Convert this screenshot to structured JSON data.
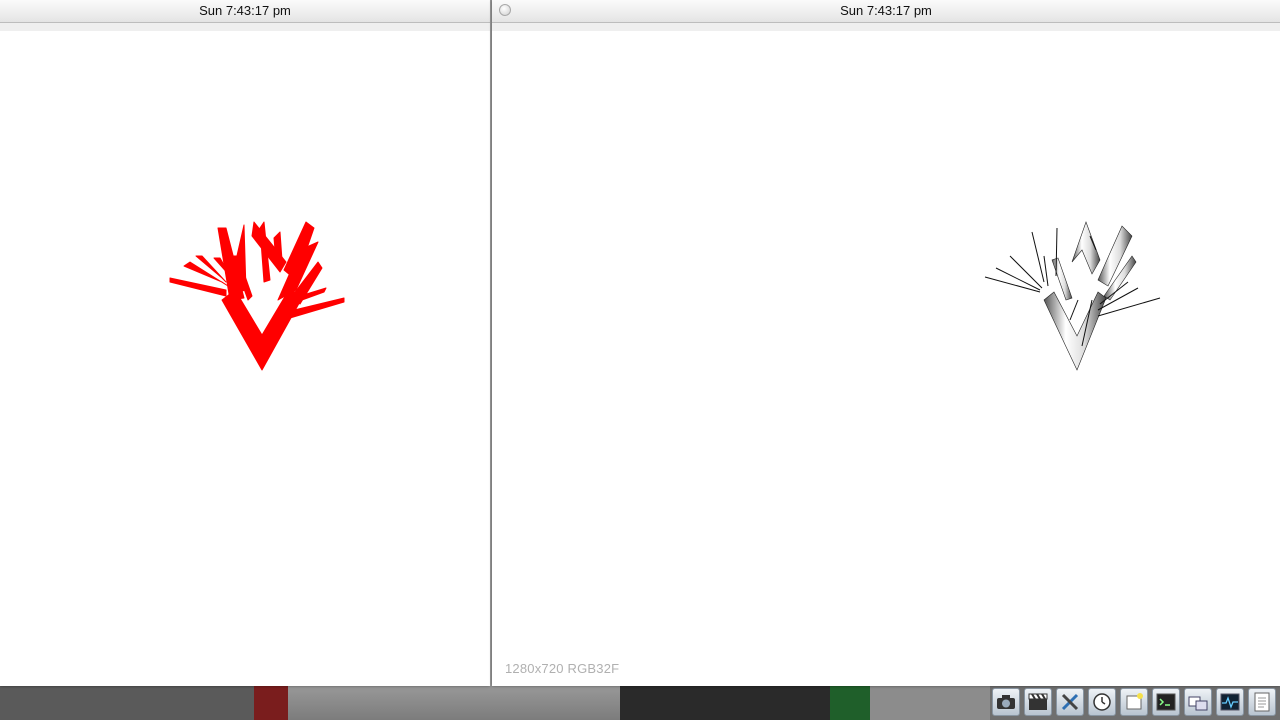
{
  "left_window": {
    "title": "Sun 7:43:17 pm",
    "render_color": "#ff0000"
  },
  "right_window": {
    "title": "Sun 7:43:17 pm",
    "resolution_label": "1280x720 RGB32F"
  },
  "dock": {
    "items": [
      {
        "icon": "camera-icon"
      },
      {
        "icon": "clapperboard-icon"
      },
      {
        "icon": "tools-icon"
      },
      {
        "icon": "clock-icon"
      },
      {
        "icon": "new-window-icon"
      },
      {
        "icon": "terminal-icon"
      },
      {
        "icon": "windows-icon"
      },
      {
        "icon": "activity-monitor-icon"
      },
      {
        "icon": "document-icon"
      }
    ]
  }
}
